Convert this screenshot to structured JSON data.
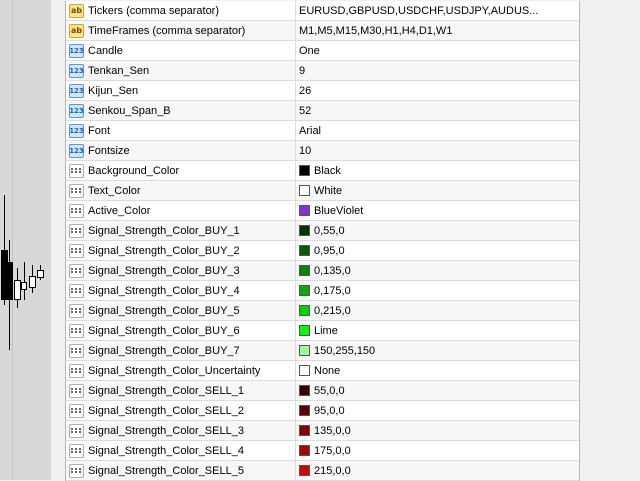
{
  "params": [
    {
      "name": "Tickers (comma separator)",
      "icon": "ab",
      "value": "EURUSD,GBPUSD,USDCHF,USDJPY,AUDUS..."
    },
    {
      "name": "TimeFrames (comma separator)",
      "icon": "ab",
      "value": "M1,M5,M15,M30,H1,H4,D1,W1"
    },
    {
      "name": "Candle",
      "icon": "num",
      "value": "One"
    },
    {
      "name": "Tenkan_Sen",
      "icon": "num",
      "value": "9"
    },
    {
      "name": "Kijun_Sen",
      "icon": "num",
      "value": "26"
    },
    {
      "name": "Senkou_Span_B",
      "icon": "num",
      "value": "52"
    },
    {
      "name": "Font",
      "icon": "num",
      "value": "Arial"
    },
    {
      "name": "Fontsize",
      "icon": "num",
      "value": "10"
    },
    {
      "name": "Background_Color",
      "icon": "color",
      "value": "Black",
      "swatch": "#000000"
    },
    {
      "name": "Text_Color",
      "icon": "color",
      "value": "White",
      "swatch": "#ffffff"
    },
    {
      "name": "Active_Color",
      "icon": "color",
      "value": "BlueViolet",
      "swatch": "#8a2be2"
    },
    {
      "name": "Signal_Strength_Color_BUY_1",
      "icon": "color",
      "value": "0,55,0",
      "swatch": "#003700"
    },
    {
      "name": "Signal_Strength_Color_BUY_2",
      "icon": "color",
      "value": "0,95,0",
      "swatch": "#005f00"
    },
    {
      "name": "Signal_Strength_Color_BUY_3",
      "icon": "color",
      "value": "0,135,0",
      "swatch": "#008700"
    },
    {
      "name": "Signal_Strength_Color_BUY_4",
      "icon": "color",
      "value": "0,175,0",
      "swatch": "#00af00"
    },
    {
      "name": "Signal_Strength_Color_BUY_5",
      "icon": "color",
      "value": "0,215,0",
      "swatch": "#00d700"
    },
    {
      "name": "Signal_Strength_Color_BUY_6",
      "icon": "color",
      "value": "Lime",
      "swatch": "#00ff00"
    },
    {
      "name": "Signal_Strength_Color_BUY_7",
      "icon": "color",
      "value": "150,255,150",
      "swatch": "#96ff96"
    },
    {
      "name": "Signal_Strength_Color_Uncertainty",
      "icon": "color",
      "value": "None",
      "swatch": "#ffffff"
    },
    {
      "name": "Signal_Strength_Color_SELL_1",
      "icon": "color",
      "value": "55,0,0",
      "swatch": "#370000"
    },
    {
      "name": "Signal_Strength_Color_SELL_2",
      "icon": "color",
      "value": "95,0,0",
      "swatch": "#5f0000"
    },
    {
      "name": "Signal_Strength_Color_SELL_3",
      "icon": "color",
      "value": "135,0,0",
      "swatch": "#870000"
    },
    {
      "name": "Signal_Strength_Color_SELL_4",
      "icon": "color",
      "value": "175,0,0",
      "swatch": "#af0000"
    },
    {
      "name": "Signal_Strength_Color_SELL_5",
      "icon": "color",
      "value": "215,0,0",
      "swatch": "#d70000"
    }
  ]
}
